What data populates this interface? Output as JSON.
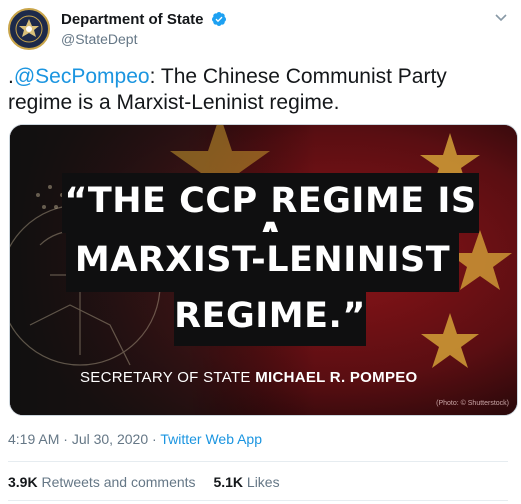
{
  "account": {
    "display_name": "Department of State",
    "handle": "@StateDept",
    "verified_icon": "verified-badge-icon",
    "avatar_icon": "department-seal-icon"
  },
  "tweet": {
    "prefix": ".",
    "mention": "@SecPompeo",
    "text_rest": ": The Chinese Communist Party regime is a Marxist-Leninist regime."
  },
  "media": {
    "quote_line1": "“THE CCP REGIME IS A",
    "quote_line2": "MARXIST-LENINIST",
    "quote_line3": "REGIME.”",
    "attrib_plain": "SECRETARY OF STATE ",
    "attrib_bold": "MICHAEL R. POMPEO",
    "photo_credit": "(Photo: © Shutterstock)"
  },
  "meta": {
    "time": "4:19 AM",
    "sep1": " · ",
    "date": "Jul 30, 2020",
    "sep2": " · ",
    "source": "Twitter Web App"
  },
  "stats": {
    "retweets_count": "3.9K",
    "retweets_label": " Retweets and comments",
    "likes_count": "5.1K",
    "likes_label": " Likes"
  },
  "colors": {
    "link": "#1b95e0",
    "secondary_text": "#657786",
    "primary_text": "#14171a",
    "flag_red": "#b3161c",
    "star_gold": "#e0b23a"
  }
}
